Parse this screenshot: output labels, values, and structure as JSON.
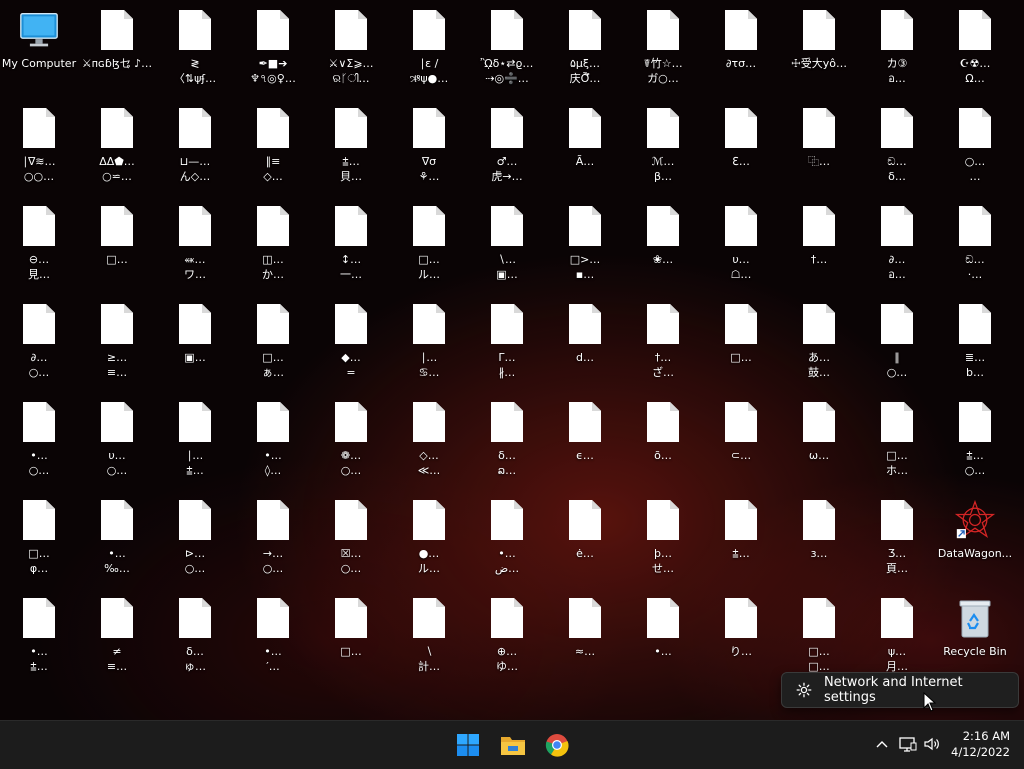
{
  "desktop": {
    "icon_columns": 13,
    "rows": [
      [
        {
          "type": "computer",
          "l1": "My Computer",
          "l2": ""
        },
        {
          "type": "file",
          "l1": "⚔ᴨɢɓɮㆥ ♪…",
          "l2": ""
        },
        {
          "type": "file",
          "l1": "≷",
          "l2": "〈⇅ψʄ…"
        },
        {
          "type": "file",
          "l1": "✒■➔",
          "l2": "♆৭◎♀…"
        },
        {
          "type": "file",
          "l1": "⚔∨Σ⩾…",
          "l2": "ରᚴി…"
        },
        {
          "type": "file",
          "l1": "∣ε /",
          "l2": "ઋψ●…"
        },
        {
          "type": "file",
          "l1": "ᾪδ⋆⇄ϱ…",
          "l2": "⇢◎➗…"
        },
        {
          "type": "file",
          "l1": "۵μξ…",
          "l2": "庆Õึ…"
        },
        {
          "type": "file",
          "l1": "☤竹☆…",
          "l2": "ガ○…"
        },
        {
          "type": "file",
          "l1": "∂τσ…",
          "l2": ""
        },
        {
          "type": "file",
          "l1": "☩受大yô…",
          "l2": ""
        },
        {
          "type": "file",
          "l1": "カ③",
          "l2": "อ…"
        },
        {
          "type": "file",
          "l1": "☪☢…",
          "l2": "Ω…"
        }
      ],
      [
        {
          "type": "file",
          "l1": "∣∇≋…",
          "l2": "○○…"
        },
        {
          "type": "file",
          "l1": "ΔΔ⬟…",
          "l2": "○⋍…"
        },
        {
          "type": "file",
          "l1": "⊔—…",
          "l2": "ん◇…"
        },
        {
          "type": "file",
          "l1": "∥≡",
          "l2": "◇…"
        },
        {
          "type": "file",
          "l1": "⩲…",
          "l2": "貝…"
        },
        {
          "type": "file",
          "l1": "∇σ",
          "l2": "⚘…"
        },
        {
          "type": "file",
          "l1": "♂…",
          "l2": "虎→…"
        },
        {
          "type": "file",
          "l1": "Ã…",
          "l2": ""
        },
        {
          "type": "file",
          "l1": "ℳ…",
          "l2": "β…"
        },
        {
          "type": "file",
          "l1": "ℇ…",
          "l2": ""
        },
        {
          "type": "file",
          "l1": "⿻…",
          "l2": ""
        },
        {
          "type": "file",
          "l1": "ඞ…",
          "l2": "δ…"
        },
        {
          "type": "file",
          "l1": "○…",
          "l2": "…"
        }
      ],
      [
        {
          "type": "file",
          "l1": "⊖…",
          "l2": "見…"
        },
        {
          "type": "file",
          "l1": "□…",
          "l2": ""
        },
        {
          "type": "file",
          "l1": "⬽…",
          "l2": "ワ…"
        },
        {
          "type": "file",
          "l1": "◫…",
          "l2": "か…"
        },
        {
          "type": "file",
          "l1": "↕…",
          "l2": "一…"
        },
        {
          "type": "file",
          "l1": "□…",
          "l2": "ル…"
        },
        {
          "type": "file",
          "l1": "∖…",
          "l2": "▣…"
        },
        {
          "type": "file",
          "l1": "□>…",
          "l2": "▪…"
        },
        {
          "type": "file",
          "l1": "❀…",
          "l2": ""
        },
        {
          "type": "file",
          "l1": "υ…",
          "l2": "☖…"
        },
        {
          "type": "file",
          "l1": "†…",
          "l2": ""
        },
        {
          "type": "file",
          "l1": "∂…",
          "l2": "อ…"
        },
        {
          "type": "file",
          "l1": "ඞ…",
          "l2": "·…"
        }
      ],
      [
        {
          "type": "file",
          "l1": "∂…",
          "l2": "○…"
        },
        {
          "type": "file",
          "l1": "≥…",
          "l2": "≡…"
        },
        {
          "type": "file",
          "l1": "▣…",
          "l2": ""
        },
        {
          "type": "file",
          "l1": "□…",
          "l2": "ぁ…"
        },
        {
          "type": "file",
          "l1": "◆…",
          "l2": "="
        },
        {
          "type": "file",
          "l1": "∣…",
          "l2": "♋…"
        },
        {
          "type": "file",
          "l1": "Γ…",
          "l2": "∦…"
        },
        {
          "type": "file",
          "l1": "d…",
          "l2": ""
        },
        {
          "type": "file",
          "l1": "†…",
          "l2": "ざ…"
        },
        {
          "type": "file",
          "l1": "□…",
          "l2": ""
        },
        {
          "type": "file",
          "l1": "あ…",
          "l2": "鼓…"
        },
        {
          "type": "file",
          "l1": "∥",
          "l2": "○…"
        },
        {
          "type": "file",
          "l1": "≣…",
          "l2": "b…"
        }
      ],
      [
        {
          "type": "file",
          "l1": "•…",
          "l2": "○…"
        },
        {
          "type": "file",
          "l1": "υ…",
          "l2": "○…"
        },
        {
          "type": "file",
          "l1": "∣…",
          "l2": "⩲…"
        },
        {
          "type": "file",
          "l1": "•…",
          "l2": "◊…"
        },
        {
          "type": "file",
          "l1": "❁…",
          "l2": "○…"
        },
        {
          "type": "file",
          "l1": "◇…",
          "l2": "≪…"
        },
        {
          "type": "file",
          "l1": "δ…",
          "l2": "ລ…"
        },
        {
          "type": "file",
          "l1": "ϵ…",
          "l2": ""
        },
        {
          "type": "file",
          "l1": "õ…",
          "l2": ""
        },
        {
          "type": "file",
          "l1": "⊂…",
          "l2": ""
        },
        {
          "type": "file",
          "l1": "ω…",
          "l2": ""
        },
        {
          "type": "file",
          "l1": "□…",
          "l2": "ホ…"
        },
        {
          "type": "file",
          "l1": "⩲…",
          "l2": "○…"
        }
      ],
      [
        {
          "type": "file",
          "l1": "□…",
          "l2": "φ…"
        },
        {
          "type": "file",
          "l1": "•…",
          "l2": "‰…"
        },
        {
          "type": "file",
          "l1": "⊳…",
          "l2": "○…"
        },
        {
          "type": "file",
          "l1": "→…",
          "l2": "○…"
        },
        {
          "type": "file",
          "l1": "☒…",
          "l2": "○…"
        },
        {
          "type": "file",
          "l1": "●…",
          "l2": "ル…"
        },
        {
          "type": "file",
          "l1": "•…",
          "l2": "ض…"
        },
        {
          "type": "file",
          "l1": "ė…",
          "l2": ""
        },
        {
          "type": "file",
          "l1": "þ…",
          "l2": "せ…"
        },
        {
          "type": "file",
          "l1": "⩲…",
          "l2": ""
        },
        {
          "type": "file",
          "l1": "з…",
          "l2": ""
        },
        {
          "type": "file",
          "l1": "Ʒ…",
          "l2": "頁…"
        },
        {
          "type": "app",
          "l1": "DataWagon...",
          "l2": ""
        }
      ],
      [
        {
          "type": "file",
          "l1": "•…",
          "l2": "⩲…"
        },
        {
          "type": "file",
          "l1": "≠",
          "l2": "≡…"
        },
        {
          "type": "file",
          "l1": "δ…",
          "l2": "ゅ…"
        },
        {
          "type": "file",
          "l1": "•…",
          "l2": "′…"
        },
        {
          "type": "file",
          "l1": "□…",
          "l2": ""
        },
        {
          "type": "file",
          "l1": "∖",
          "l2": "計…"
        },
        {
          "type": "file",
          "l1": "⊕…",
          "l2": "ゆ…"
        },
        {
          "type": "file",
          "l1": "≈…",
          "l2": ""
        },
        {
          "type": "file",
          "l1": "•…",
          "l2": ""
        },
        {
          "type": "file",
          "l1": "り…",
          "l2": ""
        },
        {
          "type": "file",
          "l1": "□…",
          "l2": "□…"
        },
        {
          "type": "file",
          "l1": "ψ…",
          "l2": "月…"
        },
        {
          "type": "recycle",
          "l1": "Recycle Bin",
          "l2": ""
        }
      ]
    ]
  },
  "popup": {
    "label": "Network and Internet settings"
  },
  "taskbar": {
    "apps": [
      "start-icon",
      "file-explorer-icon",
      "chrome-icon"
    ],
    "clock": {
      "time": "2:16 AM",
      "date": "4/12/2022"
    }
  },
  "colors": {
    "accent_blue": "#0a84ff",
    "folder_yellow": "#f5c542"
  }
}
